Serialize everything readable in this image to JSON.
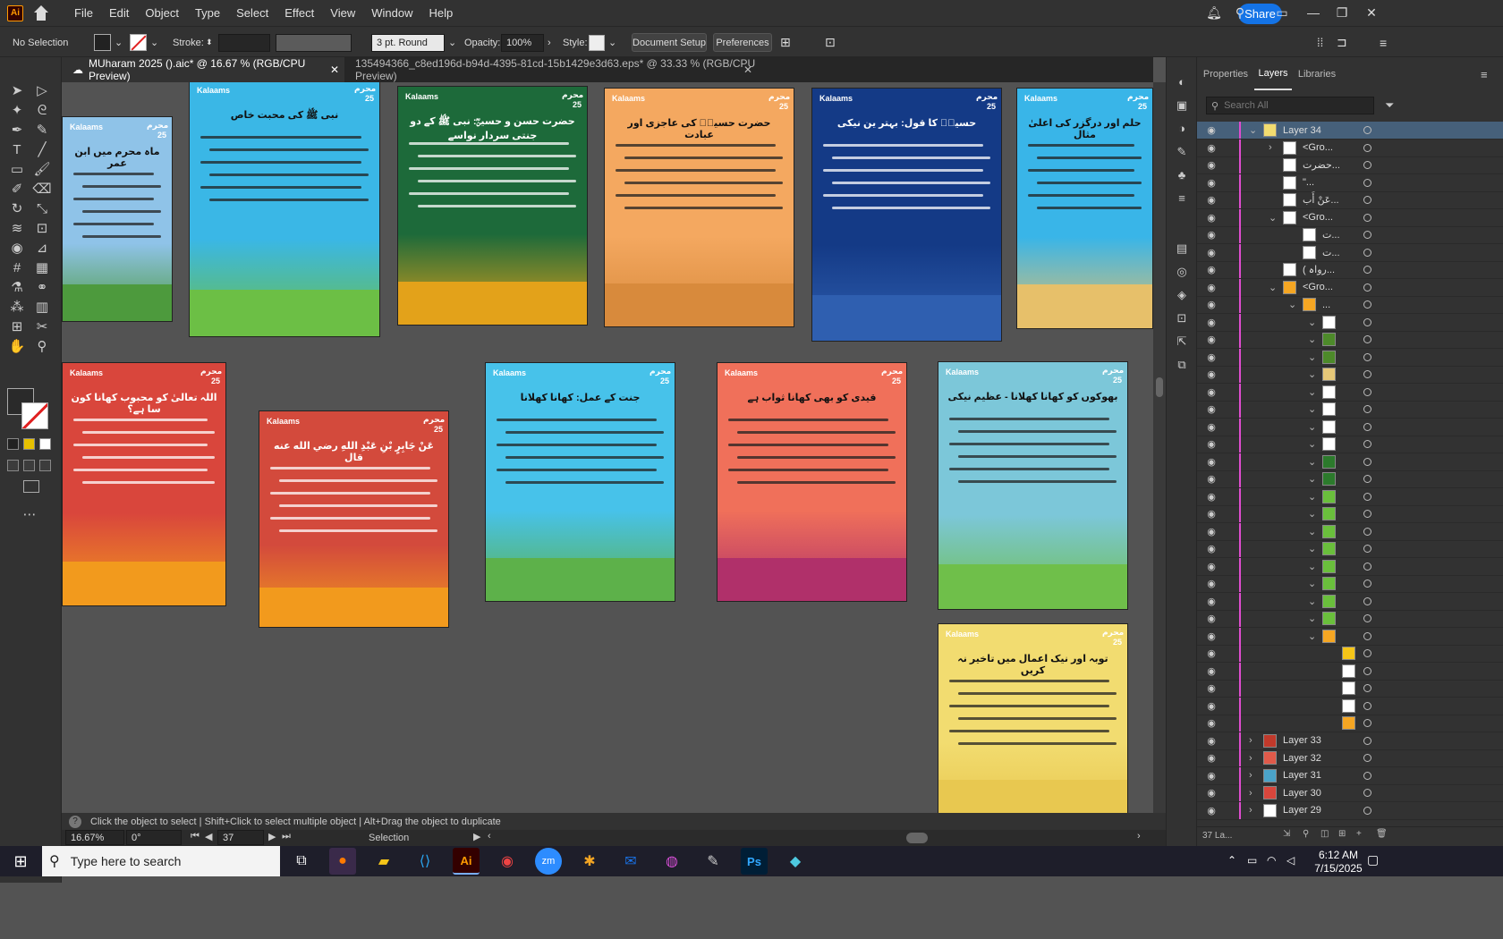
{
  "app": {
    "logo": "Ai"
  },
  "menu": [
    "File",
    "Edit",
    "Object",
    "Type",
    "Select",
    "Effect",
    "View",
    "Window",
    "Help"
  ],
  "share_label": "Share",
  "control": {
    "selection": "No Selection",
    "stroke_label": "Stroke:",
    "brush": "3 pt. Round",
    "opacity_label": "Opacity:",
    "opacity_value": "100%",
    "style_label": "Style:",
    "doc_setup": "Document Setup",
    "preferences": "Preferences"
  },
  "tabs": [
    {
      "label": "MUharam 2025 ().aic* @ 16.67 % (RGB/CPU Preview)",
      "active": true
    },
    {
      "label": "135494366_c8ed196d-b94d-4395-81cd-15b1429e3d63.eps* @ 33.33 % (RGB/CPU Preview)",
      "active": false
    }
  ],
  "posters": [
    {
      "logo": "Kalaams",
      "title": "ماہ محرم میں ابن عمر",
      "bg": "#8fc3e8",
      "ground": "#4d9a3d"
    },
    {
      "logo": "Kalaams",
      "title": "نبی ﷺ کی محبت خاص",
      "bg": "#3ab7e6",
      "ground": "#6cbf45"
    },
    {
      "logo": "Kalaams",
      "title": "حضرت حسن و حسینؓ: نبی ﷺ کے دو جنتی سردار نواسے",
      "bg": "#1d6a3a",
      "ground": "#e3a21a"
    },
    {
      "logo": "Kalaams",
      "title": "حضرت حسینؓ کی عاجزی اور عبادت",
      "bg": "#f4a860",
      "ground": "#d88a3c"
    },
    {
      "logo": "Kalaams",
      "title": "حسینؓ کا قول: بہتر ین نیکی",
      "bg": "#143a86",
      "ground": "#2f5fb0"
    },
    {
      "logo": "Kalaams",
      "title": "حلم اور درگزر کی اعلیٰ مثال",
      "bg": "#39b5e8",
      "ground": "#e7c06a"
    },
    {
      "logo": "Kalaams",
      "title": "اللہ تعالیٰ کو محبوب کھانا کون سا ہے؟",
      "bg": "#d9463c",
      "ground": "#f29a1d"
    },
    {
      "logo": "Kalaams",
      "title": "عَنْ جَابِرٍ بْنِ عَبْدِ اللهِ رضي الله عنه قال",
      "bg": "#d34a3c",
      "ground": "#f29a1d"
    },
    {
      "logo": "Kalaams",
      "title": "جنت کے عمل: کھانا کھلانا",
      "bg": "#47c2ea",
      "ground": "#5db14a"
    },
    {
      "logo": "Kalaams",
      "title": "قیدی کو بھی کھانا ثواب ہے",
      "bg": "#f0705a",
      "ground": "#b0306a"
    },
    {
      "logo": "Kalaams",
      "title": "بھوکوں کو کھانا کھلانا - عظیم نیکی",
      "bg": "#7cc7d9",
      "ground": "#6fbf4a"
    },
    {
      "logo": "Kalaams",
      "title": "توبہ اور نیک اعمال میں تاخیر نہ کریں",
      "bg": "#f2dc70",
      "ground": "#e8c850"
    }
  ],
  "poster_badge": "محرم 25",
  "status": {
    "hint": "Click the object to select  |  Shift+Click to select multiple object  |  Alt+Drag the object to duplicate",
    "zoom": "16.67%",
    "rotate": "0°",
    "artboard": "37",
    "tool": "Selection"
  },
  "panel": {
    "tabs": [
      "Properties",
      "Layers",
      "Libraries"
    ],
    "search_placeholder": "Search All",
    "layers": [
      {
        "name": "Layer 34",
        "indent": 0,
        "expanded": true,
        "thumb": "#f2dc70",
        "selected": true
      },
      {
        "name": "<Gro...",
        "indent": 1,
        "expanded": false,
        "thumb": "#ffffff"
      },
      {
        "name": "حضرت...",
        "indent": 1,
        "expanded": null,
        "thumb": "#ffffff"
      },
      {
        "name": "\"...",
        "indent": 1,
        "expanded": null,
        "thumb": "#ffffff"
      },
      {
        "name": "عَنْ أَب...",
        "indent": 1,
        "expanded": null,
        "thumb": "#ffffff"
      },
      {
        "name": "<Gro...",
        "indent": 1,
        "expanded": true,
        "thumb": "#ffffff"
      },
      {
        "name": "ت...",
        "indent": 2,
        "expanded": null,
        "thumb": "#ffffff"
      },
      {
        "name": "ت...",
        "indent": 2,
        "expanded": null,
        "thumb": "#ffffff"
      },
      {
        "name": "( رواہ...",
        "indent": 1,
        "expanded": null,
        "thumb": "#ffffff"
      },
      {
        "name": "<Gro...",
        "indent": 1,
        "expanded": true,
        "thumb": "#f5a623"
      },
      {
        "name": "...",
        "indent": 2,
        "expanded": true,
        "thumb": "#f5a623"
      }
    ],
    "sub_thumbs": [
      "#ffffff",
      "#4d8a2a",
      "#4d8a2a",
      "#e6c878",
      "#ffffff",
      "#ffffff",
      "#ffffff",
      "#ffffff",
      "#2c7a2c",
      "#2c7a2c",
      "#6abf3c",
      "#6abf3c",
      "#6abf3c",
      "#6abf3c",
      "#6abf3c",
      "#6abf3c",
      "#6abf3c",
      "#6abf3c",
      "#f5a623"
    ],
    "leaf_thumbs": [
      "#f5c518",
      "#ffffff",
      "#ffffff",
      "#ffffff",
      "#f5a623"
    ],
    "bottom_layers": [
      {
        "name": "Layer 33",
        "thumb": "#c0392b"
      },
      {
        "name": "Layer 32",
        "thumb": "#e05a4a"
      },
      {
        "name": "Layer 31",
        "thumb": "#4aa3c9"
      },
      {
        "name": "Layer 30",
        "thumb": "#d9463c"
      },
      {
        "name": "Layer 29",
        "thumb": "#ffffff"
      }
    ],
    "footer_count": "37 La..."
  },
  "taskbar": {
    "search_placeholder": "Type here to search",
    "time": "6:12 AM",
    "date": "7/15/2025"
  }
}
